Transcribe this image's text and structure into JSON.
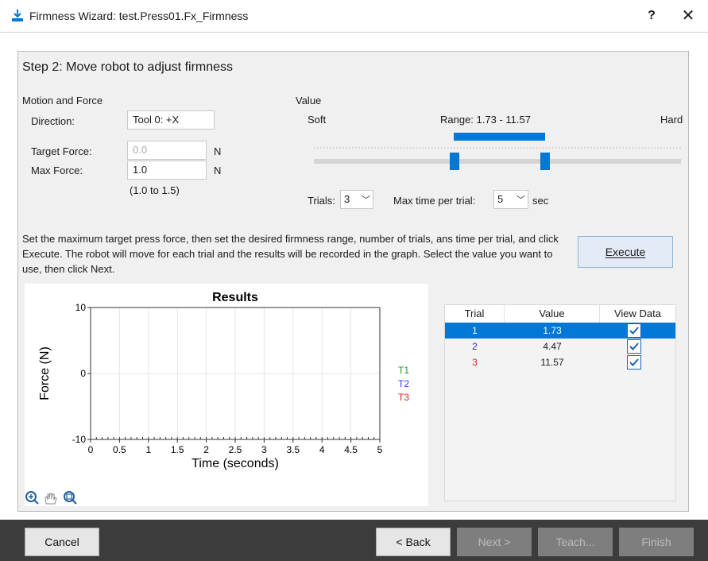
{
  "window": {
    "title": "Firmness Wizard: test.Press01.Fx_Firmness",
    "help_label": "?",
    "close_label": "✕"
  },
  "step": {
    "title": "Step 2: Move robot to adjust firmness"
  },
  "motion": {
    "section_label": "Motion and Force",
    "direction_label": "Direction:",
    "direction_value": "Tool 0: +X",
    "target_force_label": "Target Force:",
    "target_force_value": "0.0",
    "target_force_unit": "N",
    "max_force_label": "Max Force:",
    "max_force_value": "1.0",
    "max_force_unit": "N",
    "max_force_range": "(1.0 to 1.5)"
  },
  "value": {
    "section_label": "Value",
    "soft_label": "Soft",
    "hard_label": "Hard",
    "range_text": "Range: 1.73 - 11.57",
    "trials_label": "Trials:",
    "trials_value": "3",
    "max_time_label": "Max time per trial:",
    "max_time_value": "5",
    "max_time_unit": "sec"
  },
  "instructions": "Set the maximum target press force, then set the desired firmness range, number of trials, ans time per trial, and click Execute.  The robot will move for each trial and the results will be recorded in the graph.  Select the value you want to use, then click Next.",
  "execute_label": "Execute",
  "chart_data": {
    "type": "line",
    "title": "Results",
    "xlabel": "Time (seconds)",
    "ylabel": "Force (N)",
    "xlim": [
      0,
      5
    ],
    "ylim": [
      -10,
      10
    ],
    "x_ticks": [
      "0",
      "0.5",
      "1",
      "1.5",
      "2",
      "2.5",
      "3",
      "3.5",
      "4",
      "4.5",
      "5"
    ],
    "y_ticks": [
      "10",
      "0",
      "-10"
    ],
    "grid": true,
    "legend_position": "right",
    "series": [
      {
        "name": "T1",
        "color": "#1a9a1a",
        "values": []
      },
      {
        "name": "T2",
        "color": "#3a3aff",
        "values": []
      },
      {
        "name": "T3",
        "color": "#e02020",
        "values": []
      }
    ]
  },
  "table": {
    "headers": [
      "Trial",
      "Value",
      "View Data"
    ],
    "rows": [
      {
        "trial": "1",
        "value": "1.73",
        "checked": true,
        "selected": true,
        "trial_color": "#ffffff"
      },
      {
        "trial": "2",
        "value": "4.47",
        "checked": true,
        "selected": false,
        "trial_color": "#2f2fd0"
      },
      {
        "trial": "3",
        "value": "11.57",
        "checked": true,
        "selected": false,
        "trial_color": "#e02020"
      }
    ]
  },
  "buttons": {
    "cancel": "Cancel",
    "back": "< Back",
    "next": "Next >",
    "teach": "Teach...",
    "finish": "Finish"
  },
  "colors": {
    "accent": "#0078d7",
    "footer": "#3c3c3c"
  }
}
